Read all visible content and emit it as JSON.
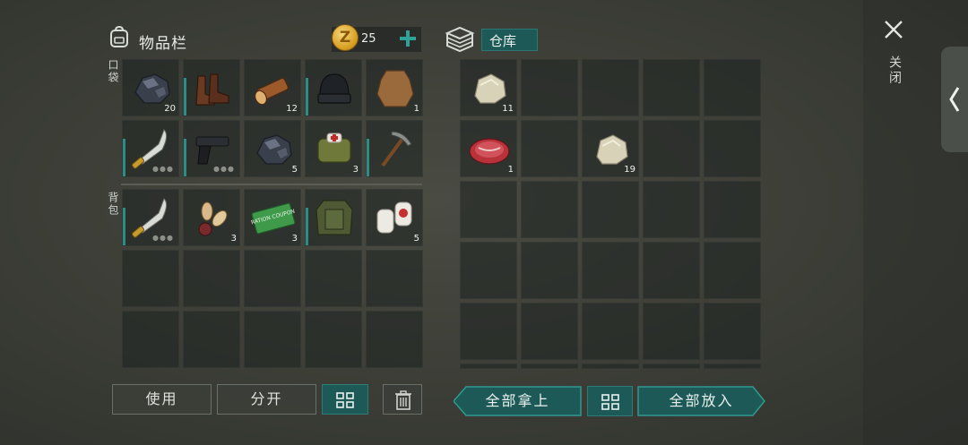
{
  "inventory": {
    "title": "物品栏",
    "coin_count": "25",
    "pocket_label": "口袋",
    "backpack_label": "背包",
    "pocket_slots": [
      {
        "item": "coal-icon",
        "qty": "20",
        "bar": false
      },
      {
        "item": "boots-icon",
        "qty": "",
        "bar": true
      },
      {
        "item": "log-icon",
        "qty": "12",
        "bar": false
      },
      {
        "item": "beanie-icon",
        "qty": "",
        "bar": true
      },
      {
        "item": "hide-icon",
        "qty": "1",
        "bar": false
      },
      {
        "item": "machete-icon",
        "qty": "",
        "bar": true,
        "dots": true
      },
      {
        "item": "pistol-icon",
        "qty": "",
        "bar": true,
        "dots": true
      },
      {
        "item": "coal-icon",
        "qty": "5",
        "bar": false
      },
      {
        "item": "medkit-bag-icon",
        "qty": "3",
        "bar": false
      },
      {
        "item": "pickaxe-icon",
        "qty": "",
        "bar": true
      }
    ],
    "backpack_slots": [
      {
        "item": "machete-icon",
        "qty": "",
        "bar": true,
        "dots": true
      },
      {
        "item": "seeds-icon",
        "qty": "3",
        "bar": false
      },
      {
        "item": "ration-coupon-icon",
        "qty": "3",
        "bar": false
      },
      {
        "item": "armor-jacket-icon",
        "qty": "",
        "bar": true
      },
      {
        "item": "bandage-icon",
        "qty": "5",
        "bar": false
      },
      {
        "item": "",
        "qty": ""
      },
      {
        "item": "",
        "qty": ""
      },
      {
        "item": "",
        "qty": ""
      },
      {
        "item": "",
        "qty": ""
      },
      {
        "item": "",
        "qty": ""
      },
      {
        "item": "",
        "qty": ""
      },
      {
        "item": "",
        "qty": ""
      },
      {
        "item": "",
        "qty": ""
      },
      {
        "item": "",
        "qty": ""
      },
      {
        "item": "",
        "qty": ""
      }
    ],
    "coupon_text": "RATION COUPON"
  },
  "storage": {
    "tab_label": "仓库",
    "slots": [
      {
        "item": "stone-icon",
        "qty": "11"
      },
      {
        "item": "",
        "qty": ""
      },
      {
        "item": "",
        "qty": ""
      },
      {
        "item": "",
        "qty": ""
      },
      {
        "item": "",
        "qty": ""
      },
      {
        "item": "raw-meat-icon",
        "qty": "1"
      },
      {
        "item": "",
        "qty": ""
      },
      {
        "item": "stone-icon",
        "qty": "19"
      },
      {
        "item": "",
        "qty": ""
      },
      {
        "item": "",
        "qty": ""
      },
      {
        "item": "",
        "qty": ""
      },
      {
        "item": "",
        "qty": ""
      },
      {
        "item": "",
        "qty": ""
      },
      {
        "item": "",
        "qty": ""
      },
      {
        "item": "",
        "qty": ""
      },
      {
        "item": "",
        "qty": ""
      },
      {
        "item": "",
        "qty": ""
      },
      {
        "item": "",
        "qty": ""
      },
      {
        "item": "",
        "qty": ""
      },
      {
        "item": "",
        "qty": ""
      },
      {
        "item": "",
        "qty": ""
      },
      {
        "item": "",
        "qty": ""
      },
      {
        "item": "",
        "qty": ""
      },
      {
        "item": "",
        "qty": ""
      },
      {
        "item": "",
        "qty": ""
      },
      {
        "item": "",
        "qty": ""
      },
      {
        "item": "",
        "qty": ""
      },
      {
        "item": "",
        "qty": ""
      },
      {
        "item": "",
        "qty": ""
      },
      {
        "item": "",
        "qty": ""
      }
    ]
  },
  "buttons": {
    "use": "使用",
    "split": "分开",
    "take_all": "全部拿上",
    "put_all": "全部放入"
  },
  "close_label": "关闭",
  "colors": {
    "accent": "#1d5a57",
    "bar": "#2b8e86"
  }
}
